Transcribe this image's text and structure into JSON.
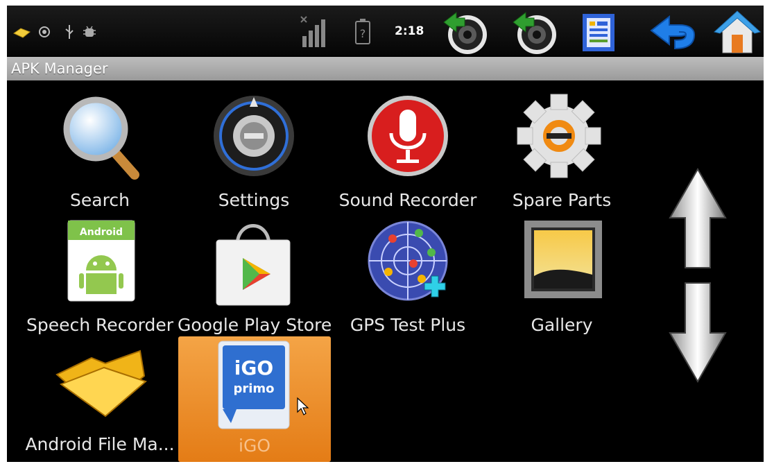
{
  "status_bar": {
    "time": "2:18",
    "icons": [
      "keyboard-icon",
      "sync-icon",
      "usb-icon",
      "debug-icon",
      "signal-icon",
      "battery-unknown-icon",
      "volume-down-icon",
      "volume-up-icon",
      "recent-apps-icon",
      "back-icon",
      "home-icon"
    ]
  },
  "window": {
    "title": "APK Manager"
  },
  "apps": [
    {
      "label": "Search"
    },
    {
      "label": "Settings"
    },
    {
      "label": "Sound Recorder"
    },
    {
      "label": "Spare Parts"
    },
    {
      "label": "Speech Recorder"
    },
    {
      "label": "Google Play Store"
    },
    {
      "label": "GPS Test Plus"
    },
    {
      "label": "Gallery"
    },
    {
      "label": "Android File Ma..."
    },
    {
      "label": "iGO",
      "selected": true,
      "icon_text_1": "iGO",
      "icon_text_2": "primo"
    }
  ],
  "speech_icon_text": "Android",
  "scroll": {
    "up": "scroll-up-arrow",
    "down": "scroll-down-arrow"
  },
  "colors": {
    "selection": "#ea8a22",
    "background": "#000000",
    "titlebar": "#a8a8a8"
  }
}
